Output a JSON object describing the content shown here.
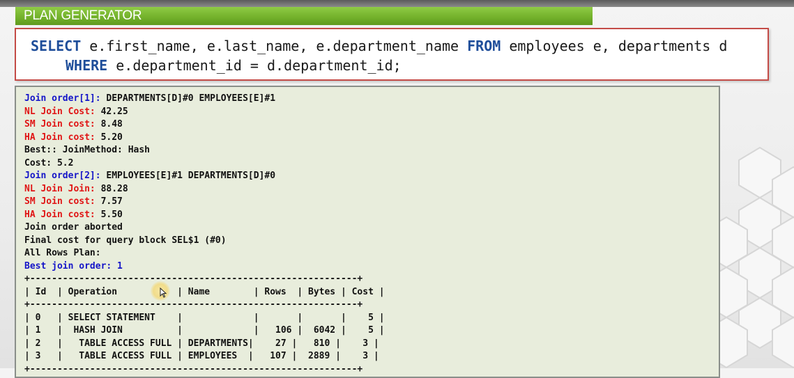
{
  "banner": {
    "title": "PLAN GENERATOR"
  },
  "sql": {
    "line1": [
      {
        "text": "SELECT",
        "kw": true
      },
      {
        "text": " e.first_name, e.last_name, e.department_name ",
        "kw": false
      },
      {
        "text": "FROM",
        "kw": true
      },
      {
        "text": " employees e, departments d",
        "kw": false
      }
    ],
    "line2": [
      {
        "text": "WHERE",
        "kw": true
      },
      {
        "text": " e.department_id = d.department_id;",
        "kw": false
      }
    ]
  },
  "trace": {
    "lines": [
      {
        "label": "Join order[1]:",
        "color": "blue",
        "text": " DEPARTMENTS[D]#0 EMPLOYEES[E]#1"
      },
      {
        "label": "NL Join Cost:",
        "color": "red",
        "text": " 42.25"
      },
      {
        "label": "SM Join cost:",
        "color": "red",
        "text": " 8.48"
      },
      {
        "label": "HA Join cost:",
        "color": "red",
        "text": " 5.20"
      },
      {
        "label": "",
        "color": "",
        "text": "Best:: JoinMethod: Hash"
      },
      {
        "label": "",
        "color": "",
        "text": "Cost: 5.2"
      },
      {
        "label": "Join order[2]:",
        "color": "blue",
        "text": " EMPLOYEES[E]#1 DEPARTMENTS[D]#0"
      },
      {
        "label": "NL Join Join:",
        "color": "red",
        "text": " 88.28"
      },
      {
        "label": "SM Join cost:",
        "color": "red",
        "text": " 7.57"
      },
      {
        "label": "HA Join cost:",
        "color": "red",
        "text": " 5.50"
      },
      {
        "label": "",
        "color": "",
        "text": "Join order aborted"
      },
      {
        "label": "",
        "color": "",
        "text": "Final cost for query block SEL$1 (#0)"
      },
      {
        "label": "",
        "color": "",
        "text": "All Rows Plan:"
      },
      {
        "label": "Best join order: 1",
        "color": "blue",
        "text": ""
      },
      {
        "label": "",
        "color": "",
        "text": "+------------------------------------------------------------+"
      },
      {
        "label": "",
        "color": "",
        "text": "| Id  | Operation           | Name        | Rows  | Bytes | Cost |"
      },
      {
        "label": "",
        "color": "",
        "text": "+------------------------------------------------------------+"
      },
      {
        "label": "",
        "color": "",
        "text": "| 0   | SELECT STATEMENT    |             |       |       |    5 |"
      },
      {
        "label": "",
        "color": "",
        "text": "| 1   |  HASH JOIN          |             |   106 |  6042 |    5 |"
      },
      {
        "label": "",
        "color": "",
        "text": "| 2   |   TABLE ACCESS FULL | DEPARTMENTS|    27 |   810 |    3 |"
      },
      {
        "label": "",
        "color": "",
        "text": "| 3   |   TABLE ACCESS FULL | EMPLOYEES  |   107 |  2889 |    3 |"
      },
      {
        "label": "",
        "color": "",
        "text": "+------------------------------------------------------------+"
      }
    ]
  },
  "colors": {
    "banner_green": "#74b22c",
    "sql_keyword": "#1f4e9a",
    "sql_border": "#c44b47",
    "trace_bg": "#e8eddc",
    "label_blue": "#1515c8",
    "label_red": "#e01515"
  }
}
